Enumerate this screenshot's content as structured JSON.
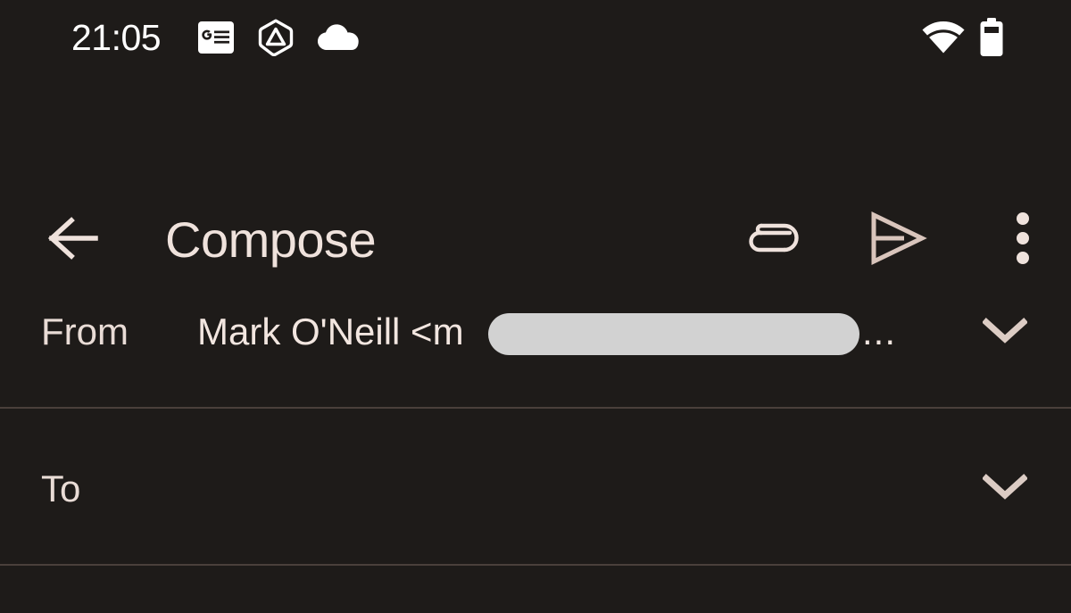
{
  "status_bar": {
    "time": "21:05",
    "left_icons": [
      {
        "name": "google-news-icon"
      },
      {
        "name": "google-drive-icon"
      },
      {
        "name": "cloud-icon"
      }
    ],
    "right_icons": [
      {
        "name": "wifi-icon"
      },
      {
        "name": "battery-icon"
      }
    ]
  },
  "app_bar": {
    "back_label": "back-arrow-icon",
    "title": "Compose",
    "actions": [
      {
        "name": "attach-file-icon"
      },
      {
        "name": "send-icon"
      },
      {
        "name": "overflow-menu-icon"
      }
    ]
  },
  "compose": {
    "from": {
      "label": "From",
      "value": "Mark O'Neill <m",
      "redacted": true,
      "truncation": "...",
      "expand_icon": "chevron-down-icon"
    },
    "to": {
      "label": "To",
      "value": "",
      "expand_icon": "chevron-down-icon"
    }
  },
  "colors": {
    "background": "#1E1B19",
    "on_surface": "#EFE2DC",
    "status_text": "#FFFFFF",
    "divider": "#4A403B",
    "redaction": "#D2D2D2"
  }
}
